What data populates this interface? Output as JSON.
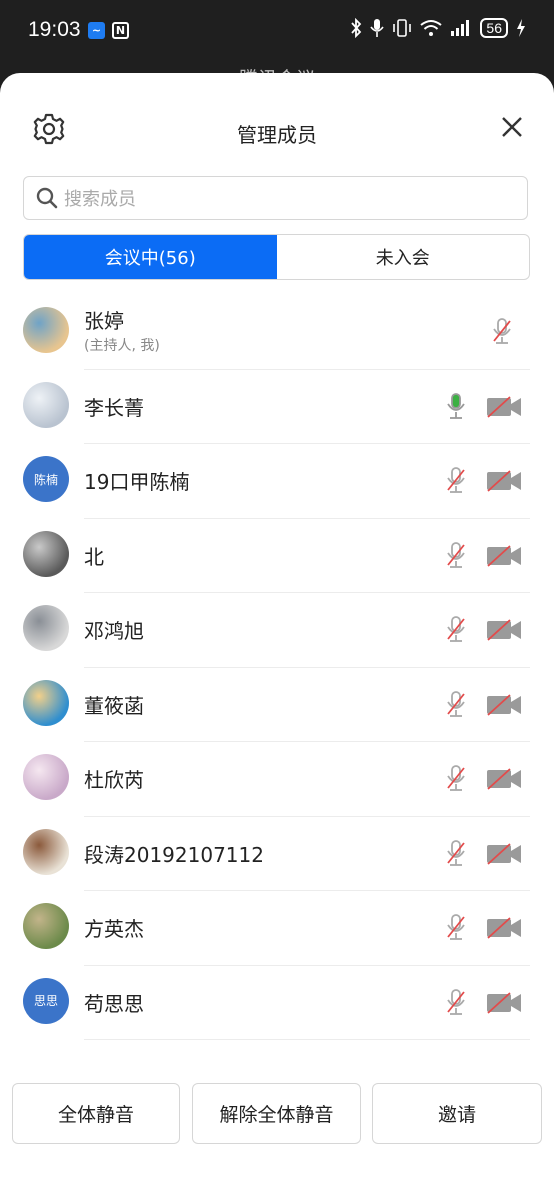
{
  "status_bar": {
    "time": "19:03",
    "battery": "56",
    "icons": [
      "bluetooth-icon",
      "mic-icon",
      "vibrate-icon",
      "wifi-icon",
      "signal-icon",
      "battery-icon",
      "charging-icon"
    ]
  },
  "background_title": "腾讯会议",
  "header": {
    "title": "管理成员",
    "settings_icon": "gear-icon",
    "close_icon": "close-icon"
  },
  "search": {
    "placeholder": "搜索成员"
  },
  "tabs": [
    {
      "label": "会议中(56)",
      "active": true
    },
    {
      "label": "未入会",
      "active": false
    }
  ],
  "members": [
    {
      "name": "张婷",
      "subtitle": "(主持人, 我)",
      "avatar": "photo",
      "avatar_text": "",
      "mic": "muted",
      "camera": "none"
    },
    {
      "name": "李长菁",
      "subtitle": "",
      "avatar": "photo",
      "avatar_text": "",
      "mic": "active",
      "camera": "off"
    },
    {
      "name": "19口甲陈楠",
      "subtitle": "",
      "avatar": "text",
      "avatar_text": "陈楠",
      "mic": "muted",
      "camera": "off"
    },
    {
      "name": "北",
      "subtitle": "",
      "avatar": "photo",
      "avatar_text": "",
      "mic": "muted",
      "camera": "off"
    },
    {
      "name": "邓鸿旭",
      "subtitle": "",
      "avatar": "photo",
      "avatar_text": "",
      "mic": "muted",
      "camera": "off"
    },
    {
      "name": "董筱菡",
      "subtitle": "",
      "avatar": "photo",
      "avatar_text": "",
      "mic": "muted",
      "camera": "off"
    },
    {
      "name": "杜欣芮",
      "subtitle": "",
      "avatar": "photo",
      "avatar_text": "",
      "mic": "muted",
      "camera": "off"
    },
    {
      "name": "段涛20192107112",
      "subtitle": "",
      "avatar": "photo",
      "avatar_text": "",
      "mic": "muted",
      "camera": "off"
    },
    {
      "name": "方英杰",
      "subtitle": "",
      "avatar": "photo",
      "avatar_text": "",
      "mic": "muted",
      "camera": "off"
    },
    {
      "name": "苟思思",
      "subtitle": "",
      "avatar": "text",
      "avatar_text": "思思",
      "mic": "muted",
      "camera": "off"
    }
  ],
  "bottom_buttons": {
    "mute_all": "全体静音",
    "unmute_all": "解除全体静音",
    "invite": "邀请"
  },
  "colors": {
    "accent": "#0b6cf5",
    "mic_active": "#3cb043",
    "muted_slash": "#e24b4b",
    "avatar_text_bg": "#3b74c9"
  }
}
